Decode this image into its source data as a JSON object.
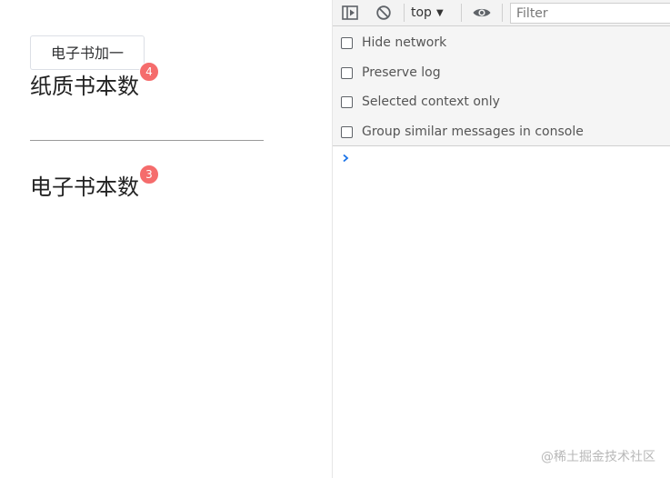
{
  "demo": {
    "add_button_label": "电子书加一",
    "paper_label": "纸质书本数",
    "paper_count": "4",
    "ebook_label": "电子书本数",
    "ebook_count": "3",
    "badge_color": "#f56c6c"
  },
  "devtools": {
    "toolbar": {
      "context": "top",
      "filter_placeholder": "Filter",
      "icons": [
        "sidebar-toggle-icon",
        "clear-console-icon",
        "eye-icon"
      ]
    },
    "settings": [
      {
        "label": "Hide network",
        "checked": false
      },
      {
        "label": "Preserve log",
        "checked": false
      },
      {
        "label": "Selected context only",
        "checked": false
      },
      {
        "label": "Group similar messages in console",
        "checked": false
      }
    ],
    "accent_color": "#1a73e8"
  },
  "watermark": "@稀土掘金技术社区"
}
